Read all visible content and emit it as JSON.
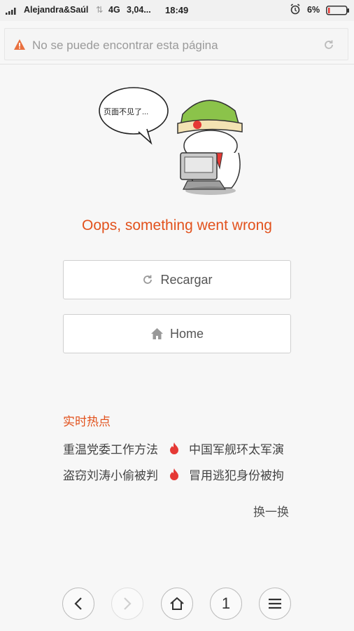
{
  "status_bar": {
    "carrier": "Alejandra&Saúl",
    "network": "4G",
    "speed": "3,04...",
    "time": "18:49",
    "battery": "6%"
  },
  "url_bar": {
    "text": "No se puede encontrar esta página"
  },
  "illustration": {
    "bubble_text": "页面不见了..."
  },
  "error": {
    "title": "Oops, something went wrong"
  },
  "buttons": {
    "reload": "Recargar",
    "home": "Home"
  },
  "hot": {
    "title": "实时热点",
    "items": [
      "重温党委工作方法",
      "中国军舰环太军演",
      "盗窃刘涛小偷被判",
      "冒用逃犯身份被拘"
    ],
    "shuffle": "换一换"
  },
  "toolbar": {
    "tabs_count": "1"
  },
  "colors": {
    "accent": "#e2521d"
  }
}
